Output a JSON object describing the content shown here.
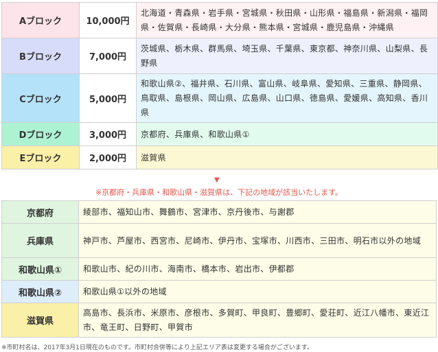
{
  "blocks": [
    {
      "name": "Aブロック",
      "amount": "10,000円",
      "prefectures": "北海道・青森県・岩手県・宮城県・秋田県・山形県・福島県・新潟県・福岡県・佐賀県・長崎県・大分県・熊本県・宮城県・鹿児島県・沖縄県",
      "color": "#fde3ea",
      "pref_bg": "#fff1f4"
    },
    {
      "name": "Bブロック",
      "amount": "7,000円",
      "prefectures": "茨城県、栃木県、群馬県、埼玉県、千葉県、東京都、神奈川県、山梨県、長野県",
      "color": "#d8dcfb",
      "pref_bg": "#eef0fe"
    },
    {
      "name": "Cブロック",
      "amount": "5,000円",
      "prefectures": "和歌山県②、福井県、石川県、富山県、岐阜県、愛知県、三重県、静岡県、鳥取県、島根県、岡山県、広島県、山口県、徳島県、愛媛県、高知県、香川県",
      "color": "#b4e2f8",
      "pref_bg": "#e4f5fd"
    },
    {
      "name": "Dブロック",
      "amount": "3,000円",
      "prefectures": "京都府、兵庫県、和歌山県①",
      "color": "#aef2d4",
      "pref_bg": "#e2fbef"
    },
    {
      "name": "Eブロック",
      "amount": "2,000円",
      "prefectures": "滋賀県",
      "color": "#fbf0a8",
      "pref_bg": "#fdf8d4"
    }
  ],
  "arrow": "▼",
  "note": "※京都府・兵庫県・和歌山県・滋賀県は、下記の地域が該当いたします。",
  "regions": [
    {
      "name": "京都府",
      "cities": "綾部市、福知山市、舞鶴市、宮津市、京丹後市、与謝郡",
      "color": "#dff5df"
    },
    {
      "name": "兵庫県",
      "cities": "神戸市、芦屋市、西宮市、尼崎市、伊丹市、宝塚市、川西市、三田市、明石市以外の地域",
      "color": "#dff5df"
    },
    {
      "name": "和歌山県①",
      "cities": "和歌山市、紀の川市、海南市、橋本市、岩出市、伊都郡",
      "color": "#dff5df"
    },
    {
      "name": "和歌山県②",
      "cities": "和歌山県①以外の地域",
      "color": "#ddeefa"
    },
    {
      "name": "滋賀県",
      "cities": "高島市、長浜市、米原市、彦根市、多賀町、甲良町、豊郷町、愛荘町、近江八幡市、東近江市、竜王町、日野町、甲賀市",
      "color": "#fbf0a8"
    }
  ],
  "footnote": "※市町村名は、2017年3月1日現在のものです。市町村合併等により上記エリア表は変更する場合がございます。"
}
